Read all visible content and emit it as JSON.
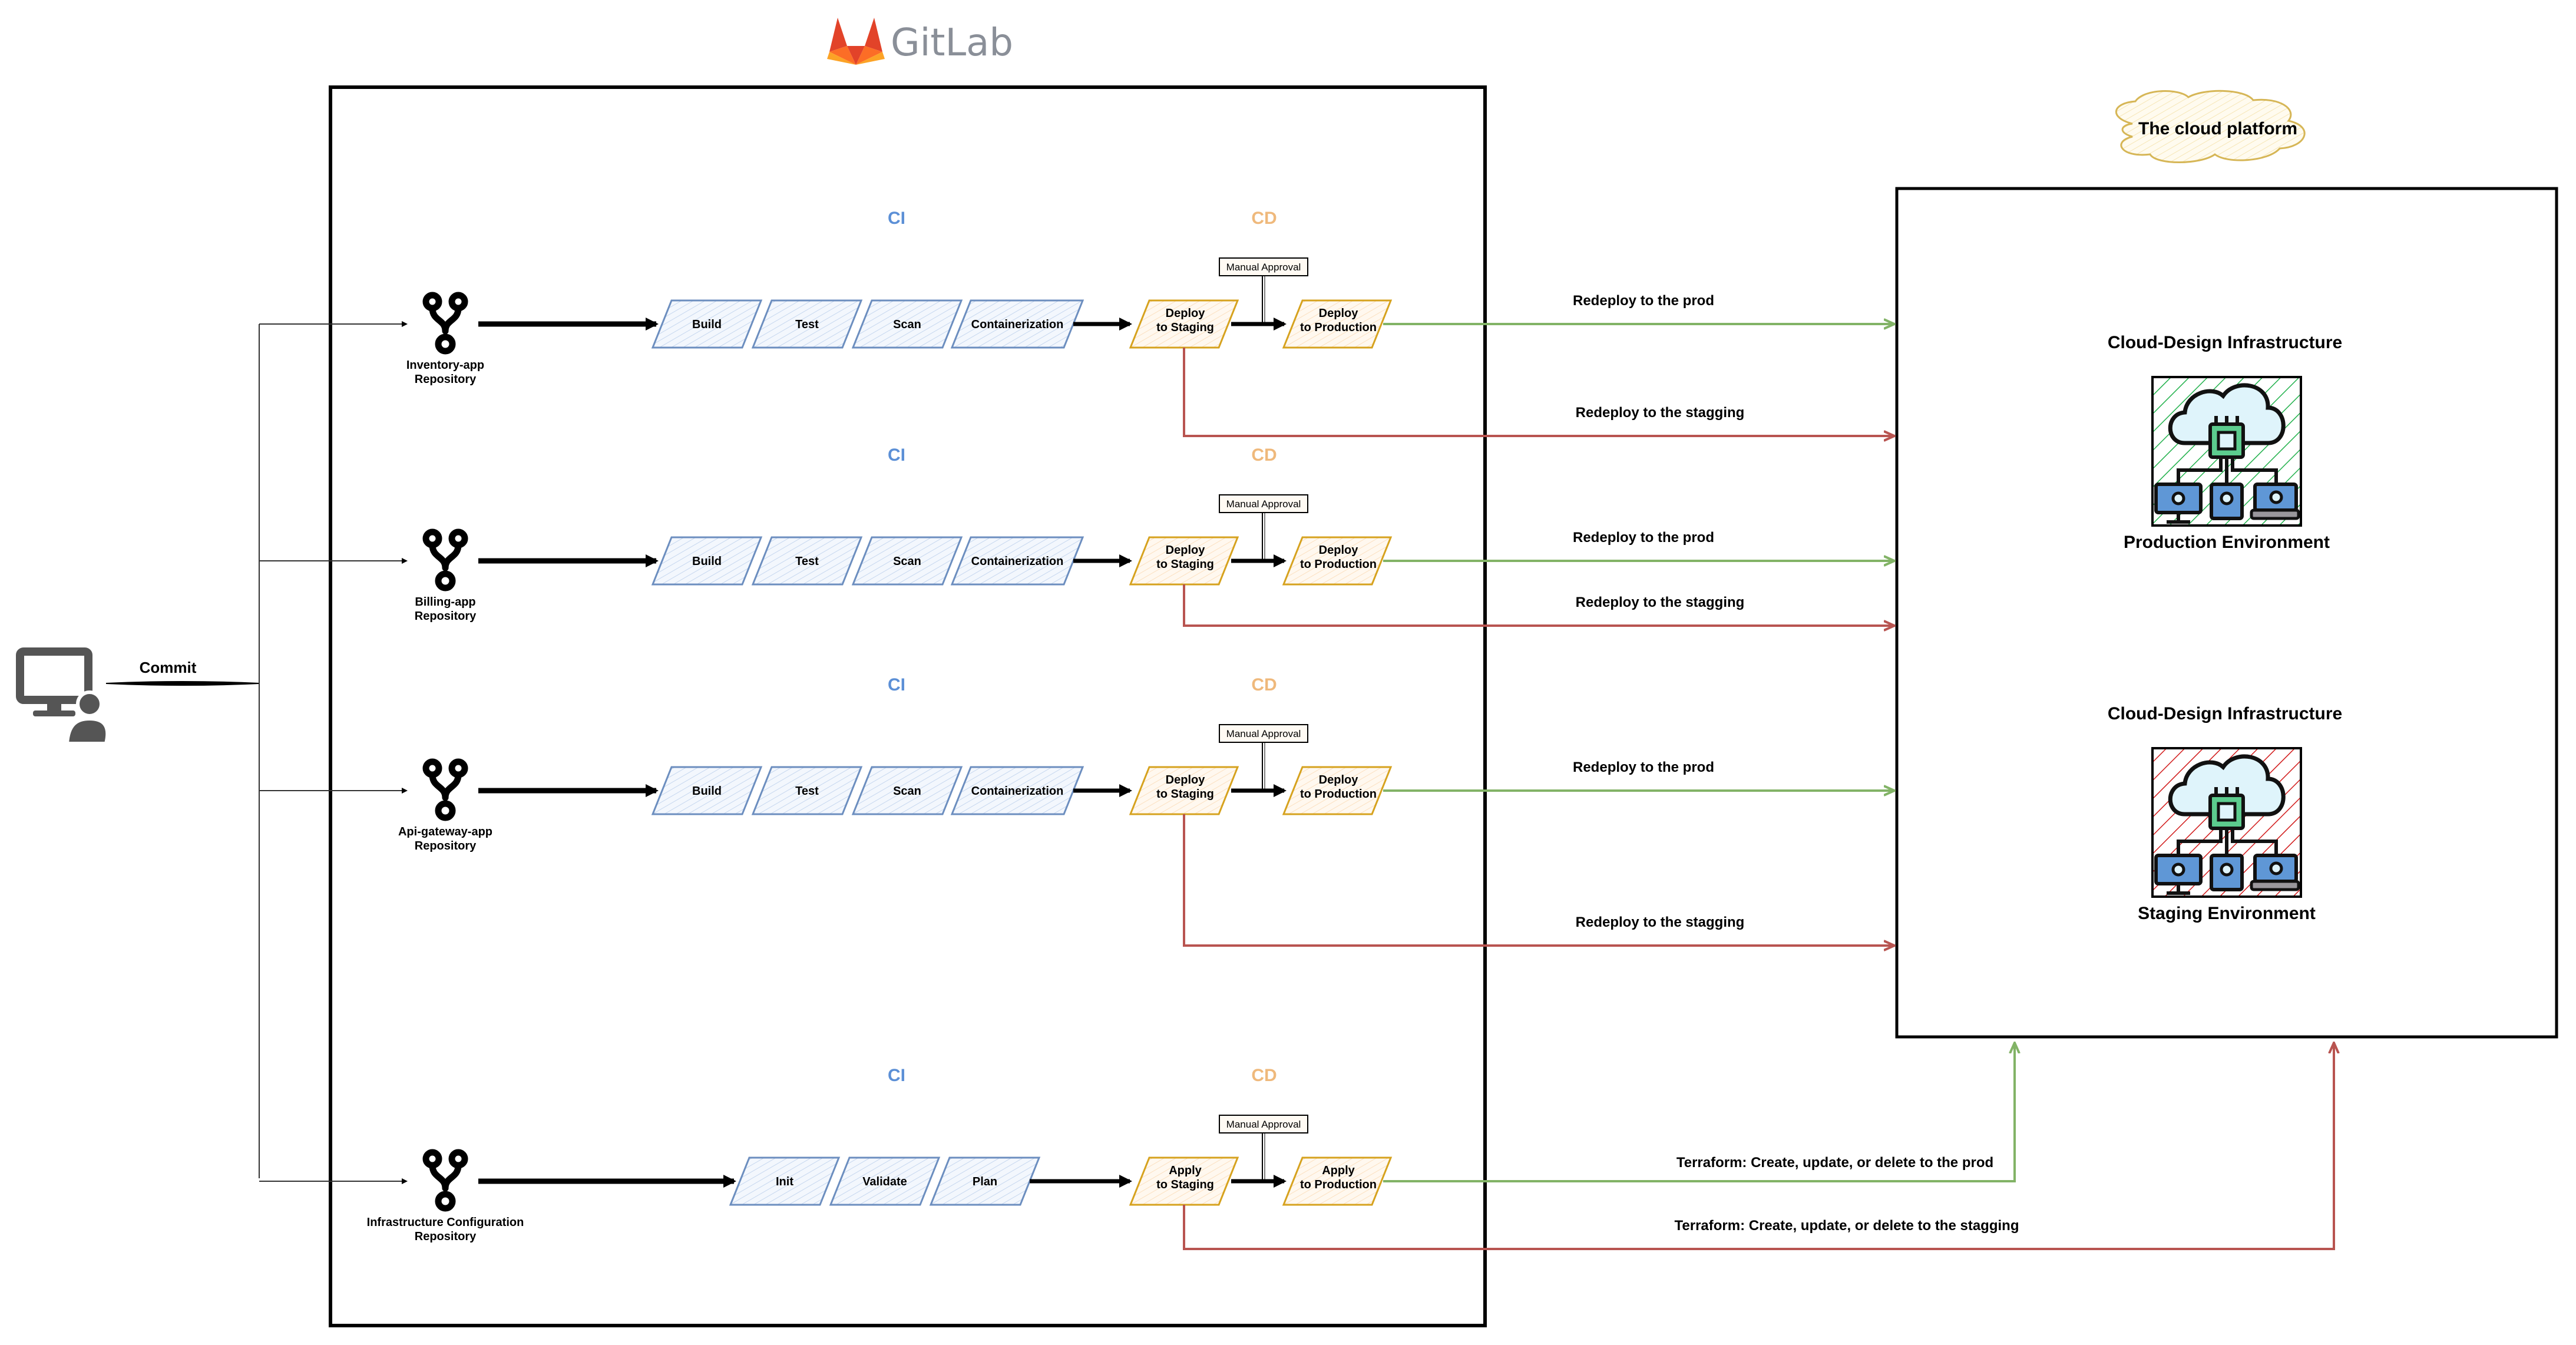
{
  "brand": {
    "name": "GitLab"
  },
  "developer": {
    "commit_label": "Commit"
  },
  "pipelines": [
    {
      "repo_name": "Inventory-app\nRepository",
      "ci_label": "CI",
      "cd_label": "CD",
      "ci_stages": [
        "Build",
        "Test",
        "Scan",
        "Containerization"
      ],
      "staging_stage": "Deploy\nto Staging",
      "prod_stage": "Deploy\nto Production",
      "approval_label": "Manual Approval",
      "prod_link_label": "Redeploy to the prod",
      "staging_link_label": "Redeploy to the stagging"
    },
    {
      "repo_name": "Billing-app\nRepository",
      "ci_label": "CI",
      "cd_label": "CD",
      "ci_stages": [
        "Build",
        "Test",
        "Scan",
        "Containerization"
      ],
      "staging_stage": "Deploy\nto Staging",
      "prod_stage": "Deploy\nto Production",
      "approval_label": "Manual Approval",
      "prod_link_label": "Redeploy to the prod",
      "staging_link_label": "Redeploy to the stagging"
    },
    {
      "repo_name": "Api-gateway-app\nRepository",
      "ci_label": "CI",
      "cd_label": "CD",
      "ci_stages": [
        "Build",
        "Test",
        "Scan",
        "Containerization"
      ],
      "staging_stage": "Deploy\nto Staging",
      "prod_stage": "Deploy\nto Production",
      "approval_label": "Manual Approval",
      "prod_link_label": "Redeploy to the prod",
      "staging_link_label": "Redeploy to the stagging"
    },
    {
      "repo_name": "Infrastructure Configuration\nRepository",
      "ci_label": "CI",
      "cd_label": "CD",
      "ci_stages": [
        "Init",
        "Validate",
        "Plan"
      ],
      "staging_stage": "Apply\nto Staging",
      "prod_stage": "Apply\nto Production",
      "approval_label": "Manual Approval",
      "prod_link_label": "Terraform: Create, update, or delete to the prod",
      "staging_link_label": "Terraform: Create, update, or delete to the stagging"
    }
  ],
  "cloud": {
    "title": "The cloud platform",
    "environments": [
      {
        "heading": "Cloud-Design Infrastructure",
        "name": "Production Environment",
        "hatch_color": "#22b14c"
      },
      {
        "heading": "Cloud-Design Infrastructure",
        "name": "Staging Environment",
        "hatch_color": "#d11a1a"
      }
    ]
  },
  "colors": {
    "ci_stage_fill": "#dae8fc",
    "ci_stage_stroke": "#6c8ebf",
    "cd_stage_fill": "#ffe6cc",
    "cd_stage_stroke": "#d6a21e",
    "prod_link": "#82b366",
    "staging_link": "#b85450",
    "ci_label": "#5b8fd6",
    "cd_label": "#efb97c"
  }
}
